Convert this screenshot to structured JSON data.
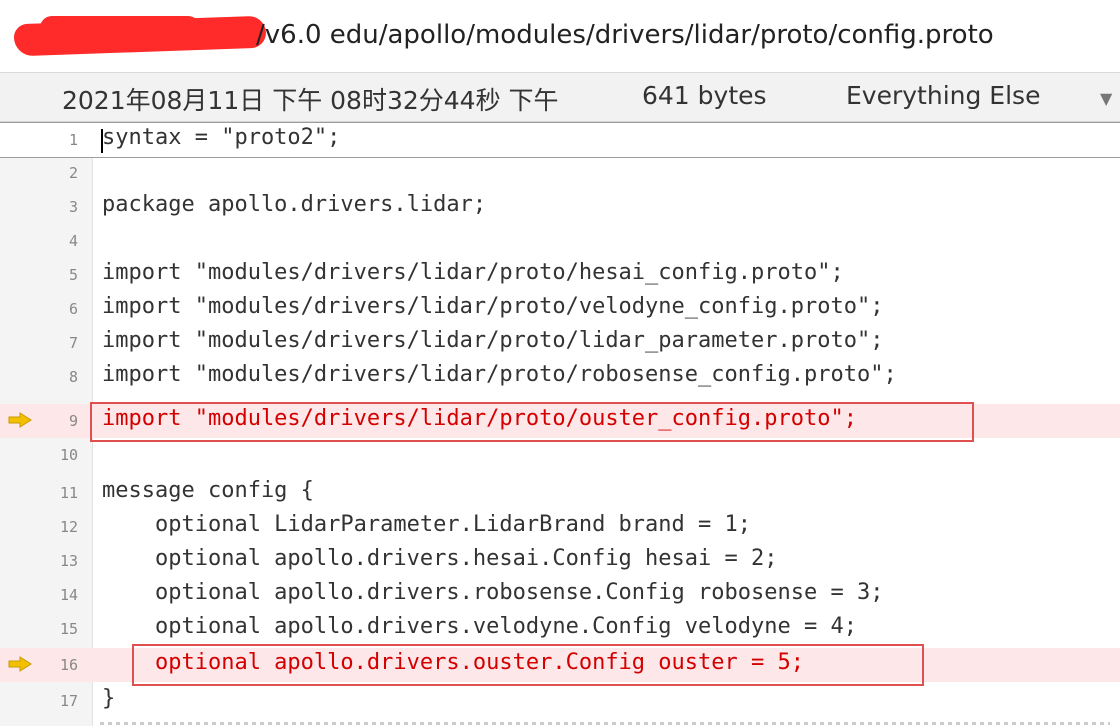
{
  "path_bar": {
    "path": "/v6.0  edu/apollo/modules/drivers/lidar/proto/config.proto"
  },
  "info_bar": {
    "timestamp": "2021年08月11日 下午 08时32分44秒 下午",
    "size": "641 bytes",
    "file_type": "Everything Else",
    "dropdown_icon": "chevron-down-icon"
  },
  "editor": {
    "lines": [
      {
        "no": "1",
        "text": "syntax = \"proto2\";"
      },
      {
        "no": "2",
        "text": ""
      },
      {
        "no": "3",
        "text": "package apollo.drivers.lidar;"
      },
      {
        "no": "4",
        "text": ""
      },
      {
        "no": "5",
        "text": "import \"modules/drivers/lidar/proto/hesai_config.proto\";"
      },
      {
        "no": "6",
        "text": "import \"modules/drivers/lidar/proto/velodyne_config.proto\";"
      },
      {
        "no": "7",
        "text": "import \"modules/drivers/lidar/proto/lidar_parameter.proto\";"
      },
      {
        "no": "8",
        "text": "import \"modules/drivers/lidar/proto/robosense_config.proto\";"
      },
      {
        "no": "9",
        "text": "import \"modules/drivers/lidar/proto/ouster_config.proto\";"
      },
      {
        "no": "10",
        "text": ""
      },
      {
        "no": "11",
        "text": "message config {"
      },
      {
        "no": "12",
        "text": "    optional LidarParameter.LidarBrand brand = 1;"
      },
      {
        "no": "13",
        "text": "    optional apollo.drivers.hesai.Config hesai = 2;"
      },
      {
        "no": "14",
        "text": "    optional apollo.drivers.robosense.Config robosense = 3;"
      },
      {
        "no": "15",
        "text": "    optional apollo.drivers.velodyne.Config velodyne = 4;"
      },
      {
        "no": "16",
        "text": "    optional apollo.drivers.ouster.Config ouster = 5;"
      },
      {
        "no": "17",
        "text": "}"
      }
    ],
    "highlight_color": "#fde7e9",
    "added_text_color": "#d40000",
    "marker_icon": "arrow-right-icon",
    "marker_color": "#f3c000"
  }
}
